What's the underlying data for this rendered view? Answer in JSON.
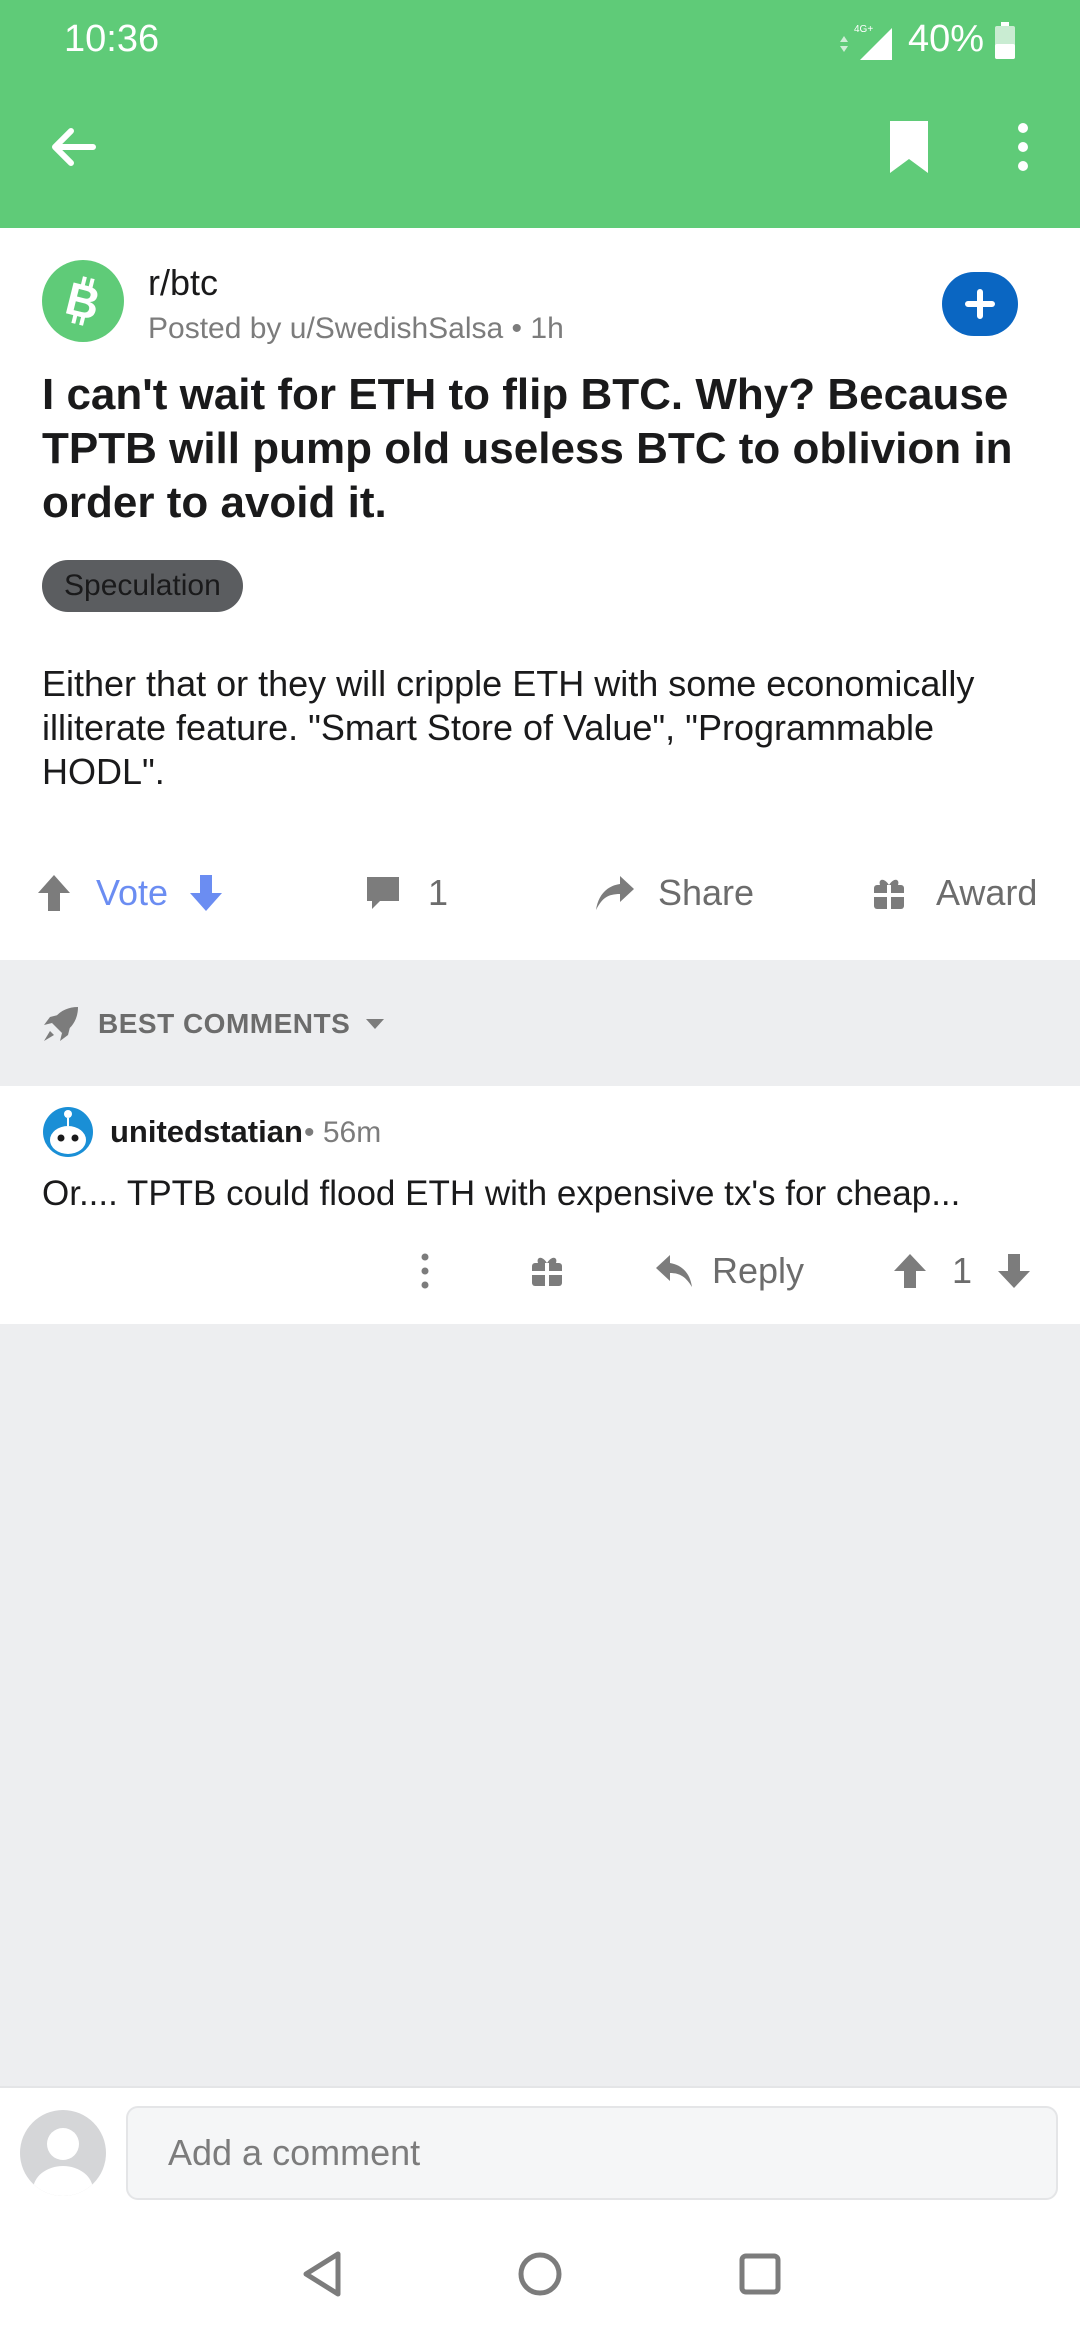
{
  "status_bar": {
    "time": "10:36",
    "network": "4G+",
    "battery": "40%"
  },
  "header": {
    "icons": [
      "back-arrow-icon",
      "bookmark-icon",
      "more-vertical-icon"
    ]
  },
  "post": {
    "subreddit": "r/btc",
    "posted_by": "Posted by u/SwedishSalsa • 1h",
    "title": "I can't wait for ETH to flip BTC. Why? Because TPTB will pump old useless BTC to oblivion in order to avoid it.",
    "flair": "Speculation",
    "body": "Either that or they will cripple ETH with some economically illiterate feature. \"Smart Store of Value\", \"Programmable HODL\".",
    "actions": {
      "vote_label": "Vote",
      "comment_count": "1",
      "share_label": "Share",
      "award_label": "Award"
    }
  },
  "comments_section": {
    "sort_label": "BEST COMMENTS"
  },
  "comments": [
    {
      "author": "unitedstatian",
      "time": "• 56m",
      "text": "Or.... TPTB could flood ETH with expensive tx's for cheap...",
      "reply_label": "Reply",
      "score": "1"
    }
  ],
  "comment_bar": {
    "placeholder": "Add a comment"
  },
  "colors": {
    "header_green": "#5fcb78",
    "join_blue": "#0a66c2",
    "vote_blue": "#6b8df2",
    "flair_gray": "#5b5d60"
  }
}
